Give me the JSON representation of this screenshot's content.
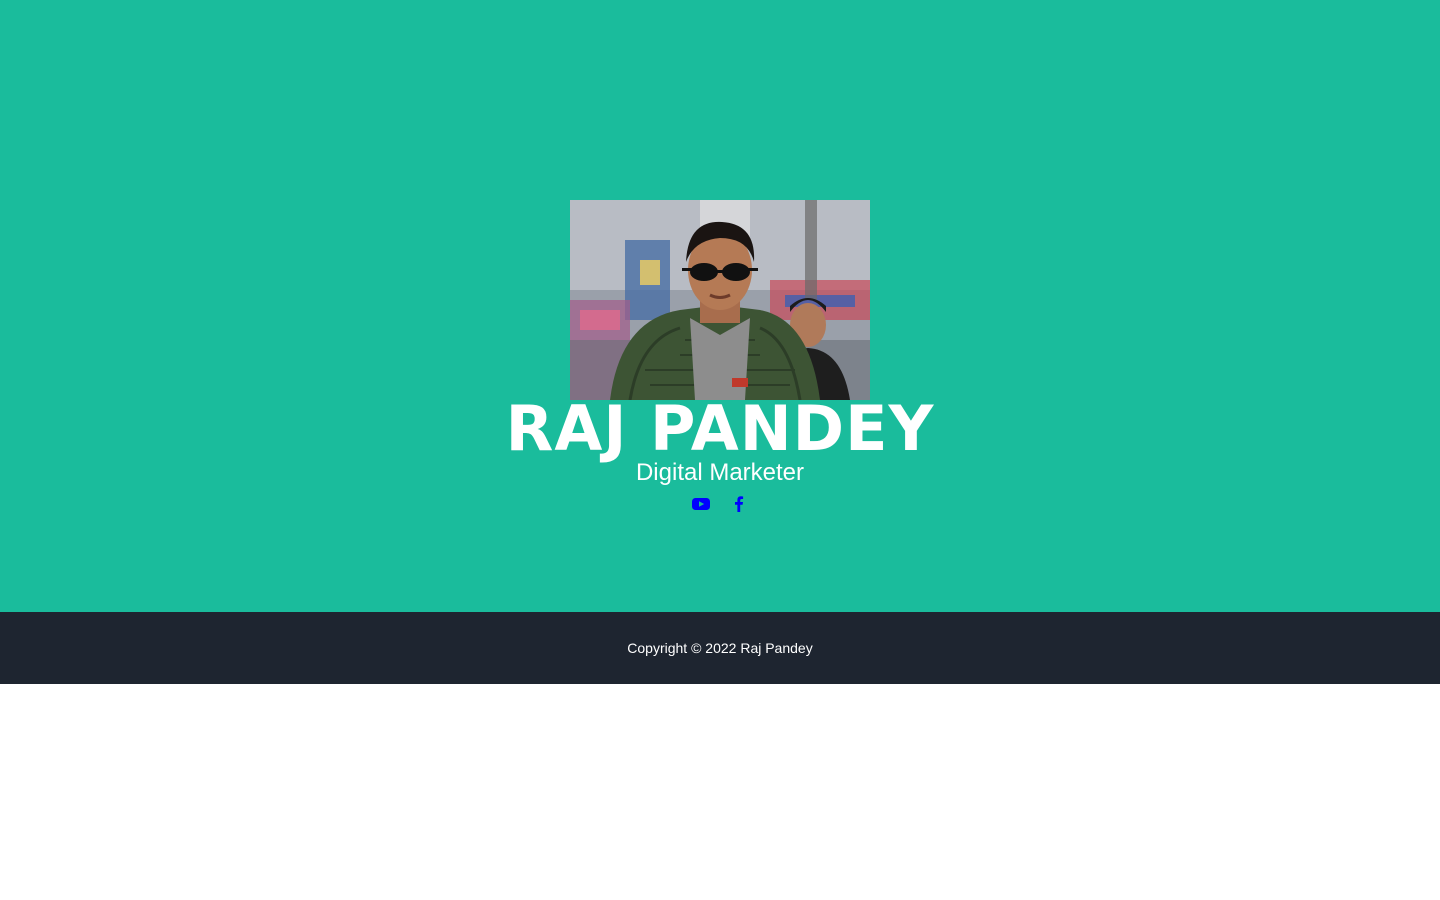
{
  "colors": {
    "hero_bg": "#1abc9c",
    "footer_bg": "#1e2530",
    "text": "#ffffff",
    "icon": "#0000ff"
  },
  "profile": {
    "name": "RAJ PANDEY",
    "title": "Digital Marketer",
    "photo_icon": "profile-photo"
  },
  "socials": [
    {
      "icon": "youtube-icon"
    },
    {
      "icon": "facebook-icon"
    }
  ],
  "footer": {
    "copyright": "Copyright © 2022 Raj Pandey"
  }
}
